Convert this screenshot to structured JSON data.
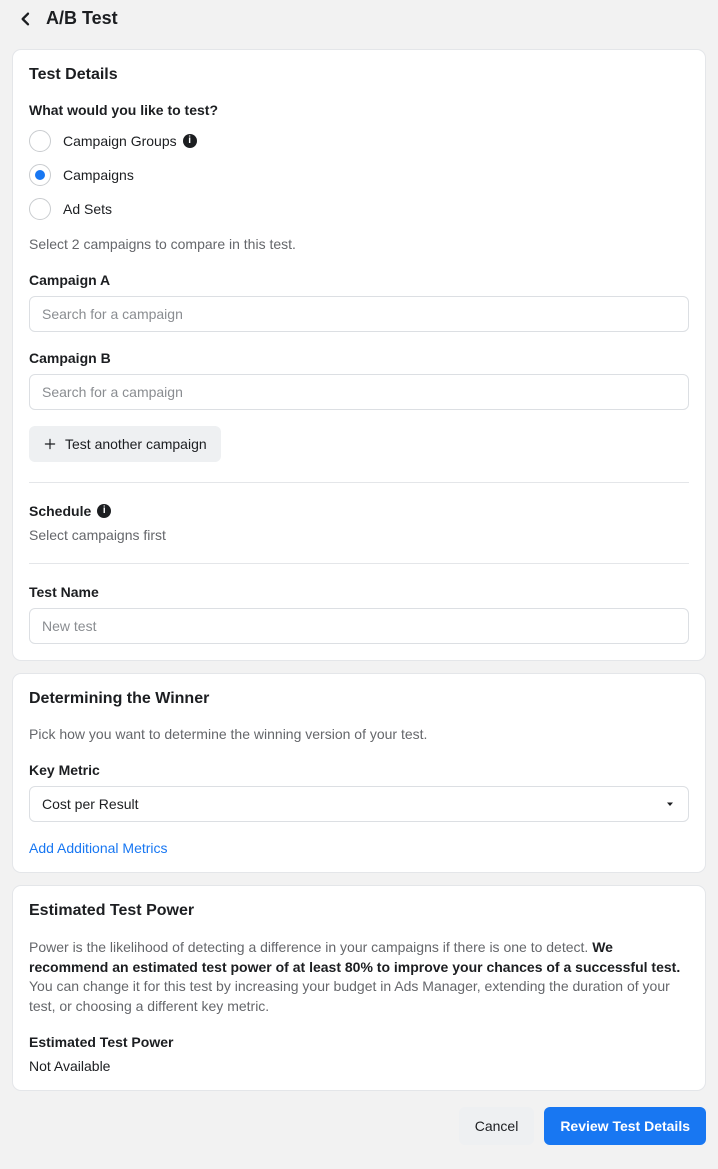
{
  "header": {
    "title": "A/B Test"
  },
  "details": {
    "section_title": "Test Details",
    "question": "What would you like to test?",
    "options": {
      "groups": "Campaign Groups",
      "campaigns": "Campaigns",
      "adsets": "Ad Sets"
    },
    "instruction": "Select 2 campaigns to compare in this test.",
    "campaign_a_label": "Campaign A",
    "campaign_a_placeholder": "Search for a campaign",
    "campaign_b_label": "Campaign B",
    "campaign_b_placeholder": "Search for a campaign",
    "add_another_button": "Test another campaign",
    "schedule_label": "Schedule",
    "schedule_hint": "Select campaigns first",
    "test_name_label": "Test Name",
    "test_name_placeholder": "New test"
  },
  "winner": {
    "section_title": "Determining the Winner",
    "description": "Pick how you want to determine the winning version of your test.",
    "key_metric_label": "Key Metric",
    "key_metric_value": "Cost per Result",
    "add_metrics_link": "Add Additional Metrics"
  },
  "power": {
    "section_title": "Estimated Test Power",
    "text_pre": "Power is the likelihood of detecting a difference in your campaigns if there is one to detect. ",
    "text_bold": "We recommend an estimated test power of at least 80% to improve your chances of a successful test. ",
    "text_post": "You can change it for this test by increasing your budget in Ads Manager, extending the duration of your test, or choosing a different key metric.",
    "label": "Estimated Test Power",
    "value": "Not Available"
  },
  "footer": {
    "cancel": "Cancel",
    "primary": "Review Test Details"
  }
}
